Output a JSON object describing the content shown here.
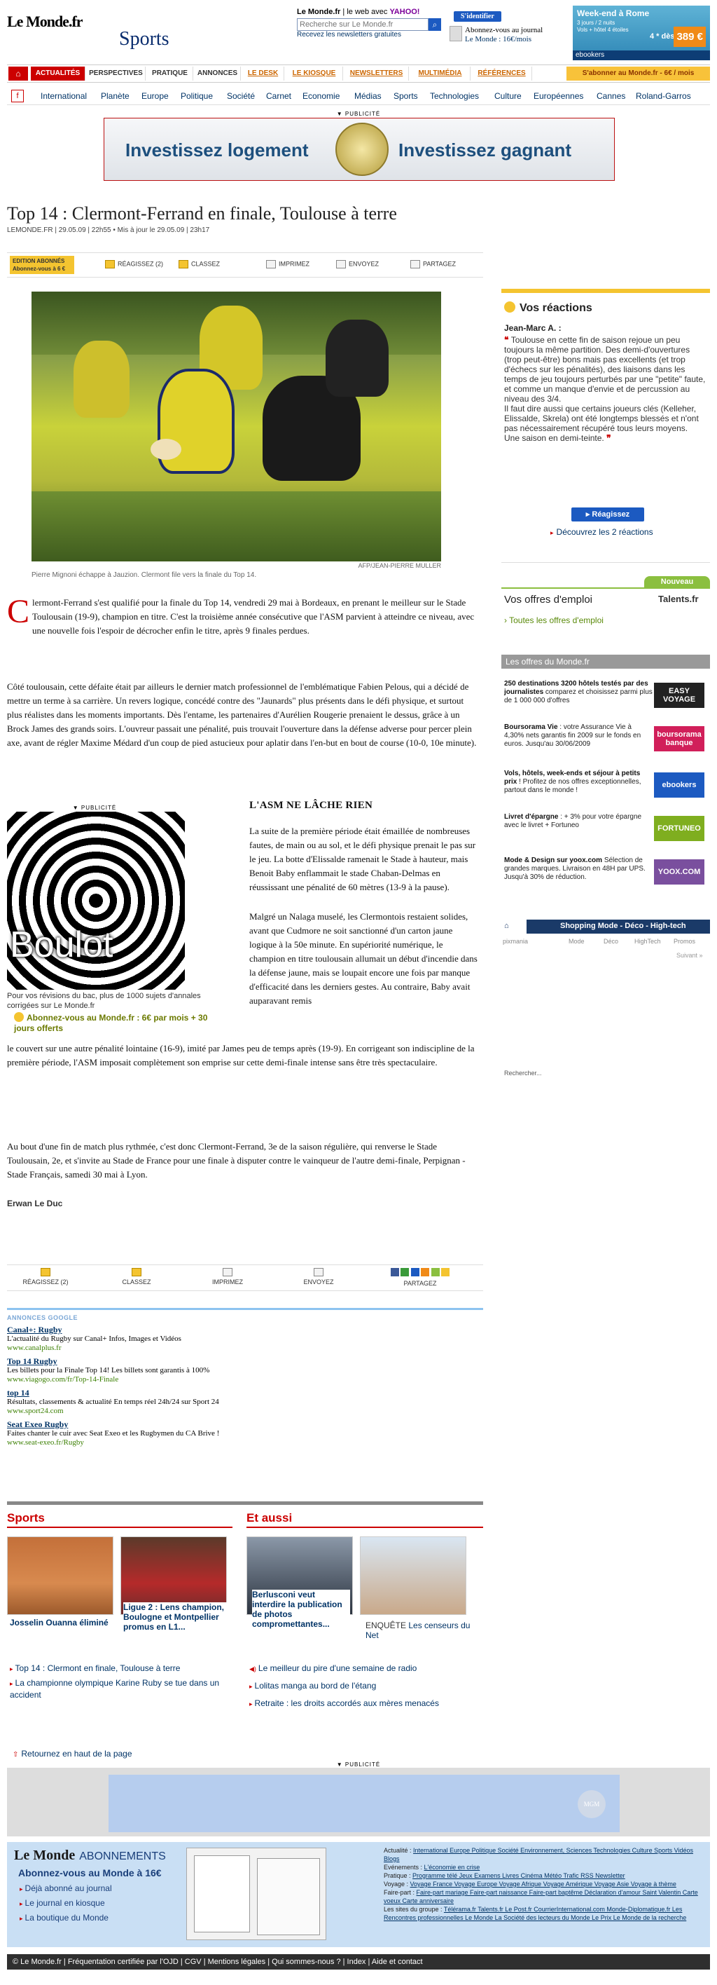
{
  "header": {
    "logo": "Le Monde.fr",
    "section": "Sports",
    "search_scope_label": "Le Monde.fr",
    "web_label": "le web avec",
    "yahoo": "YAHOO!",
    "search_placeholder": "Recherche sur Le Monde.fr",
    "newsletter_link": "Recevez les newsletters gratuites",
    "login_button": "S'identifier",
    "subscribe_line1": "Abonnez-vous au journal",
    "subscribe_line2": "Le Monde : 16€/mois",
    "ad_title": "Week-end à Rome",
    "ad_lines": "3 jours / 2 nuits\nVols + hôtel 4 étoiles",
    "ad_price": "389 €",
    "ad_brand": "ebookers",
    "ad_from": "4 * dès"
  },
  "nav1": {
    "home_icon": "home-icon",
    "items": [
      "ACTUALITÉS",
      "PERSPECTIVES",
      "PRATIQUE",
      "ANNONCES",
      "LE DESK",
      "LE KIOSQUE",
      "NEWSLETTERS",
      "MULTIMÉDIA",
      "RÉFÉRENCES"
    ],
    "subscribe": "S'abonner au Monde.fr - 6€ / mois"
  },
  "nav2": {
    "items": [
      "International",
      "Planète",
      "Europe",
      "Politique",
      "Société",
      "Carnet",
      "Economie",
      "Médias",
      "Sports",
      "Technologies",
      "Culture",
      "Européennes",
      "Cannes",
      "Roland-Garros"
    ]
  },
  "publicite_label": "▼ PUBLICITÉ",
  "banner": {
    "left": "Investissez logement",
    "right": "Investissez gagnant"
  },
  "article": {
    "title": "Top 14 : Clermont-Ferrand en finale, Toulouse à terre",
    "meta": "LEMONDE.FR | 29.05.09 | 22h55  •  Mis à jour le 29.05.09 | 23h17",
    "edition_badge": "EDITION ABONNÉS\nAbonnez-vous à 6 €",
    "tools": [
      "RÉAGISSEZ (2)",
      "CLASSEZ",
      "IMPRIMEZ",
      "ENVOYEZ",
      "PARTAGEZ"
    ],
    "photo_credit": "AFP/JEAN-PIERRE MULLER",
    "photo_caption": "Pierre Mignoni échappe à Jauzion. Clermont file vers la finale du Top 14.",
    "drop_cap": "C",
    "p1": "lermont-Ferrand s'est qualifié pour la finale du Top 14, vendredi 29 mai à Bordeaux, en prenant le meilleur sur le Stade Toulousain (19-9), champion en titre. C'est la troisième année consécutive que l'ASM parvient à atteindre ce niveau, avec une nouvelle fois l'espoir de décrocher enfin le titre, après 9 finales perdues.",
    "p2": "Côté toulousain, cette défaite était par ailleurs le dernier match professionnel de l'emblématique Fabien Pelous, qui a décidé de mettre un terme à sa carrière. Un revers logique, concédé contre des \"Jaunards\" plus présents dans le défi physique, et surtout plus réalistes dans les moments importants. Dès l'entame, les partenaires d'Aurélien Rougerie prenaient le dessus, grâce à un Brock James des grands soirs. L'ouvreur passait une pénalité, puis trouvait l'ouverture dans la défense adverse pour percer plein axe, avant de régler Maxime Médard d'un coup de pied astucieux pour aplatir dans l'en-but en bout de course (10-0, 10e minute).",
    "subhead": "L'ASM NE LÂCHE RIEN",
    "p3": "La suite de la première période était émaillée de nombreuses fautes, de main ou au sol, et le défi physique prenait le pas sur le jeu. La botte d'Elissalde ramenait le Stade à hauteur, mais Benoit Baby enflammait le stade Chaban-Delmas en réussissant une pénalité de 60 mètres (13-9 à la pause).",
    "p4": "Malgré un Nalaga muselé, les Clermontois restaient solides, avant que Cudmore ne soit sanctionné d'un carton jaune logique à la 50e minute. En supériorité numérique, le champion en titre toulousain allumait un début d'incendie dans la défense jaune, mais se loupait encore une fois par manque d'efficacité dans les derniers gestes. Au contraire, Baby avait auparavant remis",
    "p5": "le couvert sur une autre pénalité lointaine (16-9), imité par James peu de temps après (19-9). En corrigeant son indiscipline de la première période, l'ASM imposait complètement son emprise sur cette demi-finale intense sans être très spectaculaire.",
    "p6": "Au bout d'une fin de match plus rythmée, c'est donc Clermont-Ferrand, 3e de la saison régulière, qui renverse le Stade Toulousain, 2e, et s'invite au Stade de France pour une finale à disputer contre le vainqueur de l'autre demi-finale, Perpignan - Stade Français, samedi 30 mai à Lyon.",
    "author": "Erwan Le Duc"
  },
  "boxad": {
    "word": "Boulot",
    "text": "Pour vos révisions du bac, plus de 1000 sujets d'annales corrigées sur Le Monde.fr",
    "cta": "Abonnez-vous au Monde.fr : 6€ par mois + 30 jours offerts"
  },
  "google_ads": {
    "header": "ANNONCES GOOGLE",
    "items": [
      {
        "title": "Canal+: Rugby",
        "text": "L'actualité du Rugby sur Canal+ Infos, Images et Vidéos",
        "url": "www.canalplus.fr"
      },
      {
        "title": "Top 14 Rugby",
        "text": "Les billets pour la Finale Top 14! Les billets sont garantis à 100%",
        "url": "www.viagogo.com/fr/Top-14-Finale"
      },
      {
        "title": "top 14",
        "text": "Résultats, classements & actualité En temps réel 24h/24 sur Sport 24",
        "url": "www.sport24.com"
      },
      {
        "title": "Seat Exeo Rugby",
        "text": "Faites chanter le cuir avec Seat Exeo et les Rugbymen du CA Brive !",
        "url": "www.seat-exeo.fr/Rugby"
      }
    ]
  },
  "sports": {
    "header": "Sports",
    "thumbs": [
      {
        "caption": "Josselin Ouanna éliminé"
      },
      {
        "caption": "Ligue 2 : Lens champion, Boulogne et Montpellier promus en L1..."
      }
    ],
    "list": [
      "Top 14 : Clermont en finale, Toulouse à terre",
      "La championne olympique Karine Ruby se tue dans un accident"
    ]
  },
  "etaussi": {
    "header": "Et aussi",
    "thumbs": [
      {
        "caption": "Berlusconi veut interdire la publication de photos compromettantes..."
      },
      {
        "caption_prefix": "ENQUÊTE",
        "caption": "Les censeurs du Net"
      }
    ],
    "list": [
      "Le meilleur du pire d'une semaine de radio",
      "Lolitas manga au bord de l'étang",
      "Retraite : les droits accordés aux mères menacés"
    ]
  },
  "back_top": "Retournez en haut de la page",
  "pub2_logo": "MGM",
  "footer": {
    "logo": "Le Monde",
    "logo_suffix": "ABONNEMENTS",
    "subscribe": "Abonnez-vous au Monde à 16€",
    "links": [
      "Déjà abonné au journal",
      "Le journal en kiosque",
      "La boutique du Monde"
    ],
    "rows": [
      {
        "label": "Actualité :",
        "links": "International  Europe  Politique  Société  Environnement, Sciences  Technologies  Culture  Sports  Vidéos  Blogs"
      },
      {
        "label": "Evénements :",
        "links": "L'économie en crise"
      },
      {
        "label": "Pratique :",
        "links": "Programme télé  Jeux  Examens  Livres  Cinéma  Météo  Trafic  RSS  Newsletter"
      },
      {
        "label": "Voyage :",
        "links": "Voyage France  Voyage Europe  Voyage Afrique  Voyage Amérique  Voyage Asie  Voyage à thème"
      },
      {
        "label": "Faire-part :",
        "links": "Faire-part mariage  Faire-part naissance  Faire-part baptême  Déclaration d'amour  Saint Valentin  Carte voeux  Carte anniversaire"
      },
      {
        "label": "Les sites du groupe :",
        "links": "Télérama.fr  Talents.fr  Le Post.fr  CourrierInternational.com  Monde-Diplomatique.fr  Les Rencontres professionnelles Le Monde  La Société des lecteurs du Monde  Le Prix Le Monde de la recherche"
      }
    ]
  },
  "legal": "© Le Monde.fr | Fréquentation certifiée par l'OJD | CGV | Mentions légales | Qui sommes-nous ? | Index | Aide et contact",
  "reactions": {
    "header": "Vos réactions",
    "name": "Jean-Marc A. :",
    "text": "Toulouse en cette fin de saison rejoue un peu toujours la même partition. Des demi-d'ouvertures (trop peut-être) bons mais pas excellents (et trop d'échecs sur les pénalités), des liaisons dans les temps de jeu toujours perturbés par une \"petite\" faute, et comme un manque d'envie et de percussion au niveau des 3/4.\nIl faut dire aussi que certains joueurs clés (Kelleher, Elissalde, Skrela) ont été longtemps blessés et n'ont pas nécessairement récupéré tous leurs moyens.\nUne saison en demi-teinte.",
    "button": "Réagissez",
    "link": "Découvrez les 2 réactions"
  },
  "emploi": {
    "badge": "Nouveau",
    "header": "Vos offres d'emploi",
    "brand": "Talents.fr",
    "link": "Toutes les offres d'emploi"
  },
  "offres": {
    "header": "Les offres du Monde.fr",
    "items": [
      {
        "title": "250 destinations 3200 hôtels testés par des journalistes",
        "text": "comparez et choisissez parmi plus de 1 000 000 d'offres",
        "logo": "EASY VOYAGE",
        "color": "#222"
      },
      {
        "title": "Boursorama Vie",
        "text": ": votre Assurance Vie à 4,30% nets garantis fin 2009 sur le fonds en euros. Jusqu'au 30/06/2009",
        "logo": "boursorama banque",
        "color": "#d11f5a"
      },
      {
        "title": "Vols, hôtels, week-ends et séjour à petits prix",
        "text": "! Profitez de nos offres exceptionnelles, partout dans le monde !",
        "logo": "ebookers",
        "color": "#1c5ac1"
      },
      {
        "title": "Livret d'épargne",
        "text": ": + 3% pour votre épargne avec le livret + Fortuneo",
        "logo": "FORTUNEO",
        "color": "#7fae1f"
      },
      {
        "title": "Mode & Design sur yoox.com",
        "text": "Sélection de grandes marques. Livraison en 48H par UPS. Jusqu'à 30% de réduction.",
        "logo": "YOOX.COM",
        "color": "#7a4f9e"
      }
    ]
  },
  "shopping": {
    "header": "Shopping Mode - Déco - High-tech",
    "brand": "pixmania",
    "cats": [
      "Mode",
      "Déco",
      "HighTech",
      "Promos"
    ],
    "next": "Suivant »",
    "search": "Rechercher..."
  }
}
